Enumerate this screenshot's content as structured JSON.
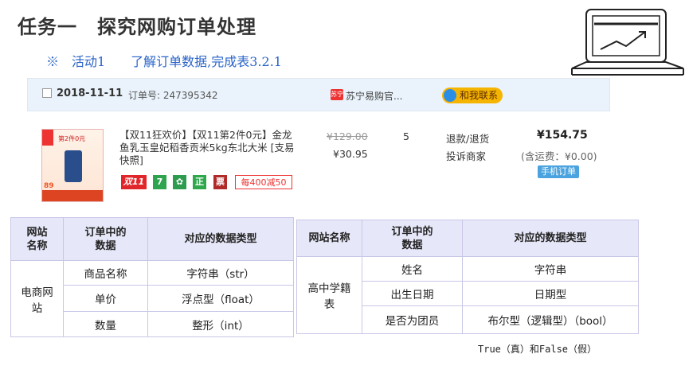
{
  "title": "任务一　探究网购订单处理",
  "subtitle": "※　活动1　　了解订单数据,完成表3.2.1",
  "order": {
    "date": "2018-11-11",
    "order_no": "订单号: 247395342",
    "shop_icon": "苏宁",
    "shop_name": "苏宁易购官...",
    "contact": "和我联系",
    "image": {
      "top_text": "第2件0元",
      "price_text": "89"
    },
    "product_desc": "【双11狂欢价】【双11第2件0元】金龙鱼乳玉皇妃稻香贡米5kg东北大米 [支易快照]",
    "tags": [
      "双11",
      "7",
      "",
      "正",
      "票",
      "每400减50"
    ],
    "original_price": "¥129.00",
    "sale_price": "¥30.95",
    "quantity": "5",
    "action_refund": "退款/退货",
    "action_complain": "投诉商家",
    "total": "¥154.75",
    "shipping": "(含运费：¥0.00)",
    "mobile_order": "手机订单"
  },
  "table1": {
    "headers": [
      "网站\n名称",
      "订单中的\n数据",
      "对应的数据类型"
    ],
    "group": "电商网\n站",
    "rows": [
      [
        "商品名称",
        "字符串（str）"
      ],
      [
        "单价",
        "浮点型（float）"
      ],
      [
        "数量",
        "整形（int）"
      ]
    ]
  },
  "table2": {
    "headers": [
      "网站名称",
      "订单中的\n数据",
      "对应的数据类型"
    ],
    "group": "高中学籍\n表",
    "rows": [
      [
        "姓名",
        "字符串"
      ],
      [
        "出生日期",
        "日期型"
      ],
      [
        "是否为团员",
        "布尔型（逻辑型）（bool）"
      ]
    ]
  },
  "note": "True（真）和False（假）"
}
